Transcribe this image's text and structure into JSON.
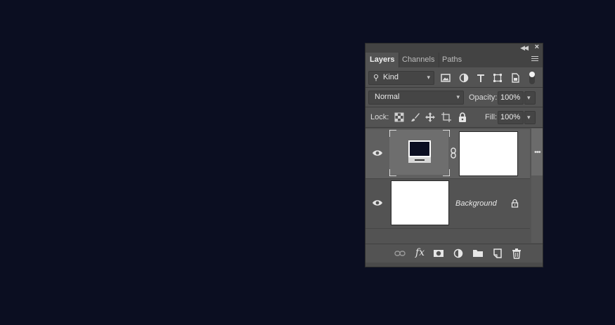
{
  "panel": {
    "tabs": [
      {
        "label": "Layers",
        "active": true
      },
      {
        "label": "Channels",
        "active": false
      },
      {
        "label": "Paths",
        "active": false
      }
    ]
  },
  "filter": {
    "kind_label": "Kind",
    "icons": [
      "image-filter-icon",
      "adjustment-filter-icon",
      "type-filter-icon",
      "shape-filter-icon",
      "smart-object-filter-icon",
      "filter-toggle-icon"
    ]
  },
  "blend": {
    "mode": "Normal",
    "opacity_label": "Opacity:",
    "opacity_value": "100%"
  },
  "lock": {
    "label": "Lock:",
    "icons": [
      "lock-transparent-pixels-icon",
      "lock-image-pixels-icon",
      "lock-position-icon",
      "lock-artboard-icon",
      "lock-all-icon"
    ],
    "fill_label": "Fill:",
    "fill_value": "100%"
  },
  "layers": [
    {
      "name": "",
      "selected": true,
      "thumbnail": "smart-object-computer-icon",
      "has_mask": true,
      "visible": true
    },
    {
      "name": "Background",
      "selected": false,
      "thumbnail": "white",
      "locked": true,
      "visible": true
    }
  ],
  "bottom_icons": [
    "link-layers-icon",
    "fx-icon",
    "add-mask-icon",
    "new-adjustment-layer-icon",
    "new-group-icon",
    "new-layer-icon",
    "delete-layer-icon"
  ],
  "colors": {
    "canvas_bg": "#0b0e21",
    "panel_bg": "#535353",
    "selected_row": "#606060"
  },
  "bottom_fx_label": "fx"
}
